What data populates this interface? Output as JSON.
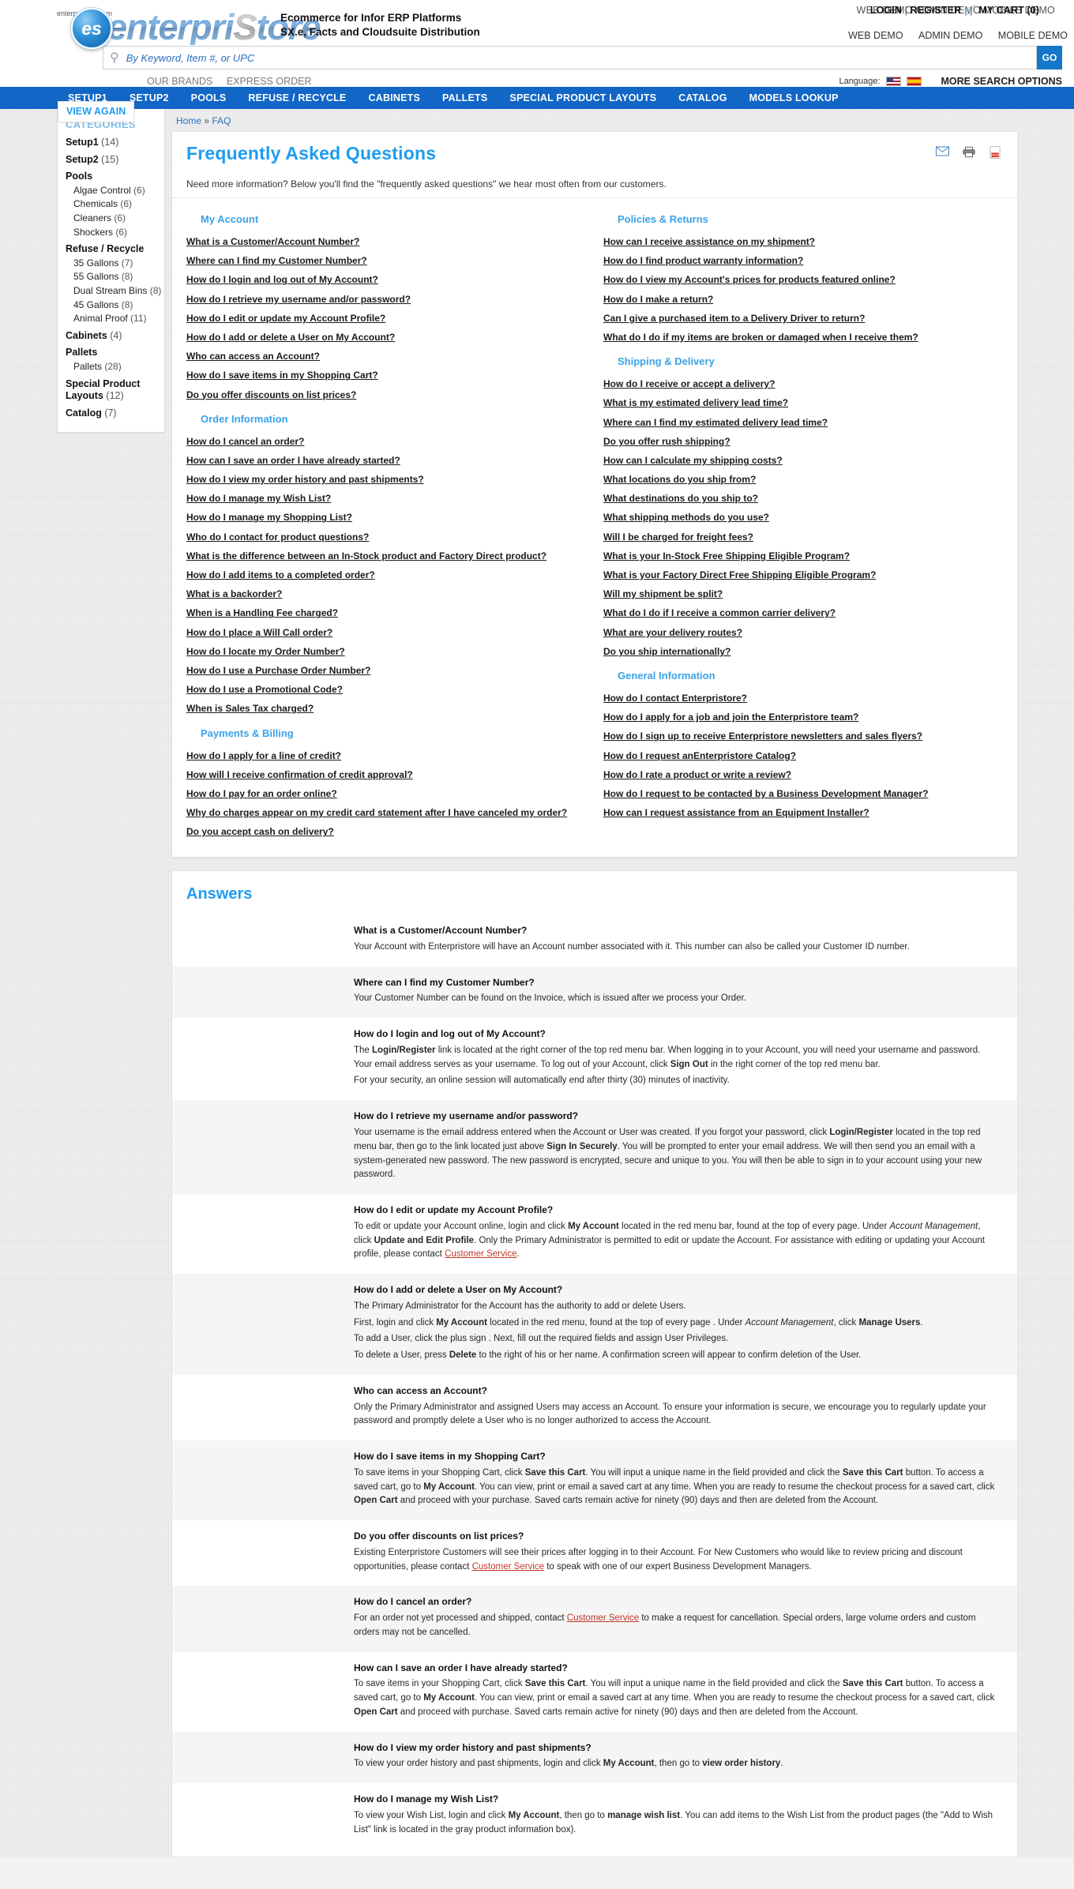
{
  "header": {
    "logo_domain": "enterpristore.com",
    "logo_badge": "es",
    "logo_word_1": "enterpri",
    "logo_word_grey": "S",
    "logo_word_2": "tore",
    "tagline_line1": "Ecommerce for Infor ERP Platforms",
    "tagline_line2": "SX.e, Facts and Cloudsuite Distribution",
    "overlap_back": "WEB DEMO   ADMIN DEMO   MOBILE DEMO",
    "login_label": "LOGIN",
    "login_sep": " | ",
    "register_label": "REGISTER",
    "cart_icon": "cart-icon",
    "cart_label": "MY CART (0)",
    "demo_links": [
      "WEB DEMO",
      "ADMIN DEMO",
      "MOBILE DEMO"
    ],
    "search_placeholder": "By Keyword, Item #, or UPC",
    "search_value": "",
    "go_label": "GO",
    "util_links": [
      "OUR BRANDS",
      "EXPRESS ORDER"
    ],
    "language_label": "Language:",
    "flags": [
      "us-flag",
      "spain-flag"
    ],
    "more_search_options": "MORE SEARCH OPTIONS"
  },
  "nav": {
    "items": [
      "SETUP1",
      "SETUP2",
      "POOLS",
      "REFUSE / RECYCLE",
      "CABINETS",
      "PALLETS",
      "SPECIAL PRODUCT LAYOUTS",
      "CATALOG",
      "MODELS LOOKUP"
    ]
  },
  "sidebar": {
    "view_again": "VIEW AGAIN",
    "categories_title": "CATEGORIES",
    "groups": [
      {
        "label": "Setup1",
        "count": "(14)",
        "subs": []
      },
      {
        "label": "Setup2",
        "count": "(15)",
        "subs": []
      },
      {
        "label": "Pools",
        "count": "",
        "subs": [
          {
            "label": "Algae Control",
            "count": "(6)"
          },
          {
            "label": "Chemicals",
            "count": "(6)"
          },
          {
            "label": "Cleaners",
            "count": "(6)"
          },
          {
            "label": "Shockers",
            "count": "(6)"
          }
        ]
      },
      {
        "label": "Refuse / Recycle",
        "count": "",
        "subs": [
          {
            "label": "35 Gallons",
            "count": "(7)"
          },
          {
            "label": "55 Gallons",
            "count": "(8)"
          },
          {
            "label": "Dual Stream Bins",
            "count": "(8)"
          },
          {
            "label": "45 Gallons",
            "count": "(8)"
          },
          {
            "label": "Animal Proof",
            "count": "(11)"
          }
        ]
      },
      {
        "label": "Cabinets",
        "count": "(4)",
        "subs": []
      },
      {
        "label": "Pallets",
        "count": "",
        "subs": [
          {
            "label": "Pallets",
            "count": "(28)"
          }
        ]
      },
      {
        "label": "Special Product Layouts",
        "count": "(12)",
        "subs": []
      },
      {
        "label": "Catalog",
        "count": "(7)",
        "subs": []
      }
    ]
  },
  "breadcrumb": {
    "home": "Home",
    "sep": "»",
    "current": "FAQ"
  },
  "faq": {
    "title": "Frequently Asked Questions",
    "intro": "Need more information? Below you'll find the \"frequently asked questions\" we hear most often from our customers.",
    "action_icons": [
      "email-icon",
      "print-icon",
      "pdf-icon"
    ],
    "left_sections": [
      {
        "title": "My Account",
        "links": [
          "What is a Customer/Account Number?",
          "Where can I find my Customer Number?",
          "How do I login and log out of My Account?",
          "How do I retrieve my username and/or password?",
          "How do I edit or update my Account Profile?",
          "How do I add or delete a User on My Account?",
          "Who can access an Account?",
          "How do I save items in my Shopping Cart?",
          "Do you offer discounts on list prices?"
        ]
      },
      {
        "title": "Order Information",
        "links": [
          "How do I cancel an order?",
          "How can I save an order I have already started?",
          "How do I view my order history and past shipments?",
          "How do I manage my Wish List?",
          "How do I manage my Shopping List?",
          "Who do I contact for product questions?",
          "What is the difference between an In-Stock product and Factory Direct product?",
          "How do I add items to a completed order?",
          "What is a backorder?",
          "When is a Handling Fee charged?",
          "How do I place a Will Call order?",
          "How do I locate my Order Number?",
          "How do I use a Purchase Order Number?",
          "How do I use a Promotional Code?",
          "When is Sales Tax charged?"
        ]
      },
      {
        "title": "Payments & Billing",
        "links": [
          "How do I apply for a line of credit?",
          "How will I receive confirmation of credit approval?",
          "How do I pay for an order online?",
          "Why do charges appear on my credit card statement after I have canceled my order?",
          "Do you accept cash on delivery?"
        ]
      }
    ],
    "right_sections": [
      {
        "title": "Policies & Returns",
        "links": [
          "How can I receive assistance on my shipment?",
          "How do I find product warranty information?",
          "How do I view my Account's prices for products featured online?",
          "How do I make a return?",
          "Can I give a purchased item to a Delivery Driver to return?",
          "What do I do if my items are broken or damaged when I receive them?"
        ]
      },
      {
        "title": "Shipping & Delivery",
        "links": [
          "How do I receive or accept a delivery?",
          "What is my estimated delivery lead time?",
          "Where can I find my estimated delivery lead time?",
          "Do you offer rush shipping?",
          "How can I calculate my shipping costs?",
          "What locations do you ship from?",
          "What destinations do you ship to?",
          "What shipping methods do you use?",
          "Will I be charged for freight fees?",
          "What is your In-Stock Free Shipping Eligible Program?",
          "What is your Factory Direct Free Shipping Eligible Program?",
          "Will my shipment be split?",
          "What do I do if I receive a common carrier delivery?",
          "What are your delivery routes?",
          "Do you ship internationally?"
        ]
      },
      {
        "title": "General Information",
        "links": [
          "How do I contact Enterpristore?",
          "How do I apply for a job and join the Enterpristore team?",
          "How do I sign up to receive Enterpristore newsletters and sales flyers?",
          "How do I request anEnterpristore Catalog?",
          "How do I rate a product or write a review?",
          "How do I request to be contacted by a Business Development Manager?",
          "How can I request assistance from an Equipment Installer?"
        ]
      }
    ]
  },
  "answers": {
    "title": "Answers",
    "items": [
      {
        "q": "What is a Customer/Account Number?",
        "paras": [
          "Your Account with Enterpristore will have an Account number associated with it. This number can also be called your Customer ID number."
        ]
      },
      {
        "q": "Where can I find my Customer Number?",
        "paras": [
          "Your Customer Number can be found on the Invoice, which is issued after we process your Order."
        ]
      },
      {
        "q": "How do I login and log out of My Account?",
        "paras": [
          "The Login/Register link is located at the right corner of the top red menu bar. When logging in to your Account, you will need your username and password. Your email address serves as your username. To log out of your Account, click Sign Out in the right corner of the top red menu bar.",
          "For your security, an online session will automatically end after thirty (30) minutes of inactivity."
        ]
      },
      {
        "q": "How do I retrieve my username and/or password?",
        "paras": [
          "Your username is the email address entered when the Account or User was created. If you forgot your password, click Login/Register located in the top red menu bar, then go to the link located just above Sign In Securely. You will be prompted to enter your email address. We will then send you an email with a system-generated new password. The new password is encrypted, secure and unique to you. You will then be able to sign in to your account using your new password."
        ]
      },
      {
        "q": "How do I edit or update my Account Profile?",
        "paras": [
          "To edit or update your Account online, login and click My Account located in the red menu bar, found at the top of every page. Under Account Management, click Update and Edit Profile. Only the Primary Administrator is permitted to edit or update the Account. For assistance with editing or updating your Account profile, please contact Customer Service."
        ]
      },
      {
        "q": "How do I add or delete a User on My Account?",
        "paras": [
          "The Primary Administrator for the Account has the authority to add or delete Users.",
          "First, login and click My Account located in the red menu, found at the top of every page . Under Account Management, click Manage Users.",
          "To add a User, click the plus sign . Next, fill out the required fields and assign User Privileges.",
          "To delete a User, press Delete to the right of his or her name. A confirmation screen will appear to confirm deletion of the User."
        ]
      },
      {
        "q": "Who can access an Account?",
        "paras": [
          "Only the Primary Administrator and assigned Users may access an Account. To ensure your information is secure, we encourage you to regularly update your password and promptly delete a User who is no longer authorized to access the Account."
        ]
      },
      {
        "q": "How do I save items in my Shopping Cart?",
        "paras": [
          "To save items in your Shopping Cart, click Save this Cart. You will input a unique name in the field provided and click the Save this Cart button. To access a saved cart, go to My Account. You can view, print or email a saved cart at any time. When you are ready to resume the checkout process for a saved cart, click Open Cart and proceed with your purchase. Saved carts remain active for ninety (90) days and then are deleted from the Account."
        ]
      },
      {
        "q": "Do you offer discounts on list prices?",
        "paras": [
          "Existing Enterpristore Customers will see their prices after logging in to their Account. For New Customers who would like to review pricing and discount opportunities, please contact Customer Service to speak with one of our expert Business Development Managers."
        ]
      },
      {
        "q": "How do I cancel an order?",
        "paras": [
          "For an order not yet processed and shipped, contact Customer Service to make a request for cancellation. Special orders, large volume orders and custom orders may not be cancelled."
        ]
      },
      {
        "q": "How can I save an order I have already started?",
        "paras": [
          "To save items in your Shopping Cart, click Save this Cart. You will input a unique name in the field provided and click the Save this Cart button. To access a saved cart, go to My Account. You can view, print or email a saved cart at any time. When you are ready to resume the checkout process for a saved cart, click Open Cart and proceed with purchase. Saved carts remain active for ninety (90) days and then are deleted from the Account."
        ]
      },
      {
        "q": "How do I view my order history and past shipments?",
        "paras": [
          "To view your order history and past shipments, login and click My Account, then go to view order history."
        ]
      },
      {
        "q": "How do I manage my Wish List?",
        "paras": [
          "To view your Wish List, login and click My Account, then go to manage wish list.  You can add items to the Wish List from the product pages (the \"Add to Wish List\" link is located in the gray product information box)."
        ]
      }
    ]
  }
}
